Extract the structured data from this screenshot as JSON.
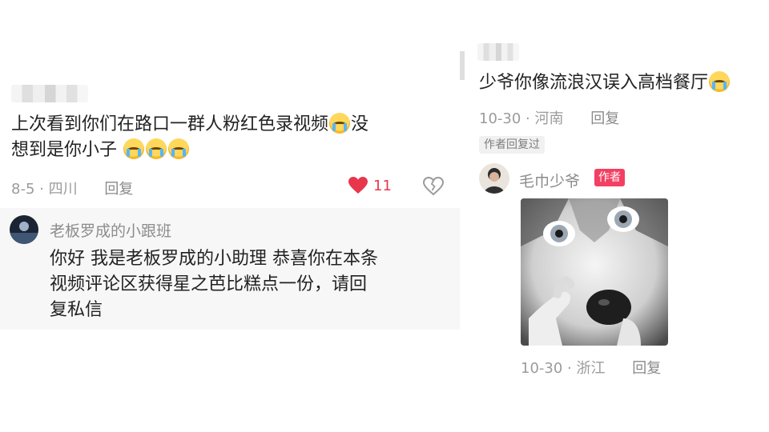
{
  "left": {
    "comment": {
      "line1": "上次看到你们在路口一群人粉红色录视频",
      "line1_tail": "没",
      "line2": "想到是你小子",
      "meta_date": "8-5",
      "meta_loc": "四川",
      "reply_label": "回复",
      "like_count": "11"
    },
    "reply": {
      "username": "老板罗成的小跟班",
      "line1": "你好 我是老板罗成的小助理 恭喜你在本条",
      "line2": "视频评论区获得星之芭比糕点一份，请回",
      "line3": "复私信"
    }
  },
  "right": {
    "comment": {
      "text": "少爷你像流浪汉误入高档餐厅",
      "meta_date": "10-30",
      "meta_loc": "河南",
      "reply_label": "回复",
      "replied_tag": "作者回复过"
    },
    "author_reply": {
      "username": "毛巾少爷",
      "author_tag": "作者",
      "meta_date": "10-30",
      "meta_loc": "浙江",
      "reply_label": "回复"
    }
  },
  "icons": {
    "emoji": "crying-face-icon",
    "heart": "heart-icon",
    "broken_heart": "dislike-icon"
  },
  "colors": {
    "like": "#e8364d",
    "author_tag_bg": "#f33f62"
  }
}
